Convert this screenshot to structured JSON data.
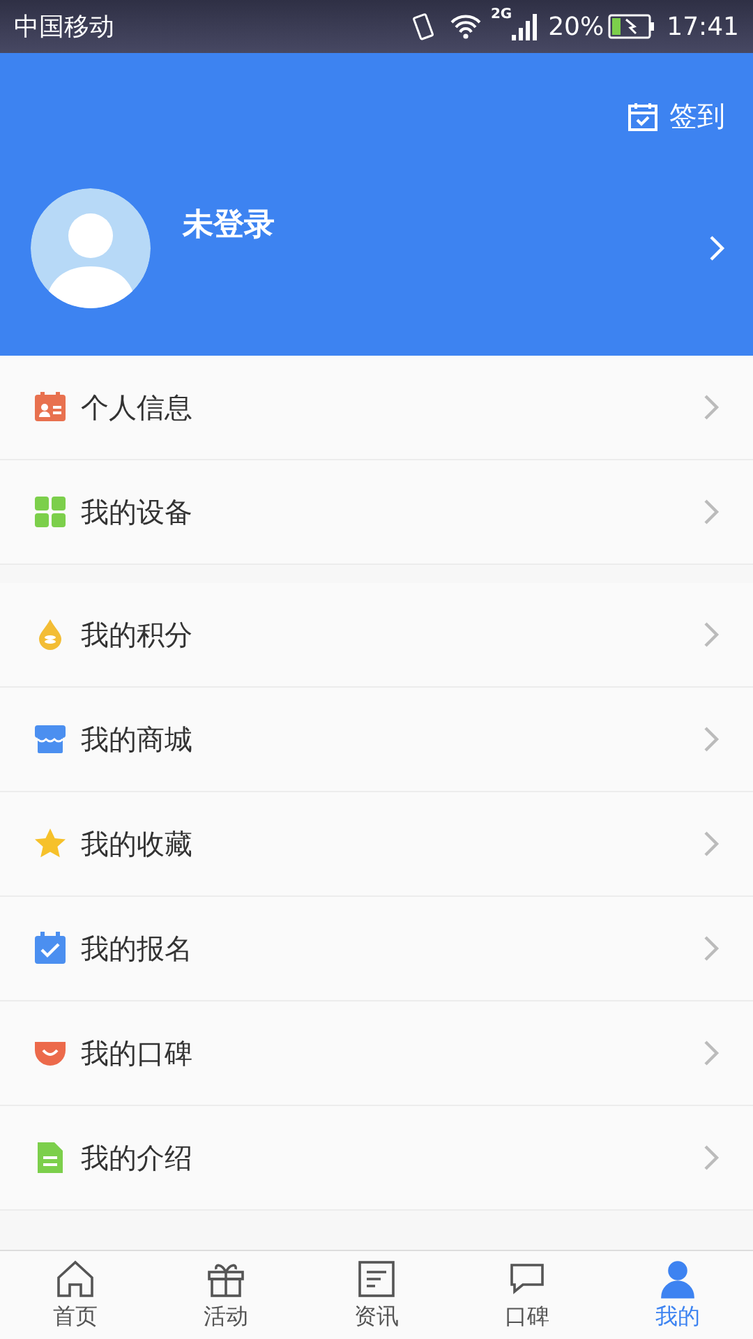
{
  "status_bar": {
    "carrier": "中国移动",
    "signal_type": "2G",
    "battery": "20%",
    "time": "17:41"
  },
  "header": {
    "checkin": "签到",
    "username": "未登录"
  },
  "groups": [
    {
      "items": [
        {
          "kind": "profile",
          "label": "个人信息"
        },
        {
          "kind": "devices",
          "label": "我的设备"
        }
      ]
    },
    {
      "items": [
        {
          "kind": "points",
          "label": "我的积分"
        },
        {
          "kind": "shop",
          "label": "我的商城"
        },
        {
          "kind": "favorites",
          "label": "我的收藏"
        },
        {
          "kind": "signup",
          "label": "我的报名"
        },
        {
          "kind": "reviews",
          "label": "我的口碑"
        },
        {
          "kind": "intro",
          "label": "我的介绍"
        }
      ]
    }
  ],
  "tabs": [
    {
      "kind": "home",
      "label": "首页",
      "selected": false
    },
    {
      "kind": "gift",
      "label": "活动",
      "selected": false
    },
    {
      "kind": "news",
      "label": "资讯",
      "selected": false
    },
    {
      "kind": "chat",
      "label": "口碑",
      "selected": false
    },
    {
      "kind": "person",
      "label": "我的",
      "selected": true
    }
  ]
}
